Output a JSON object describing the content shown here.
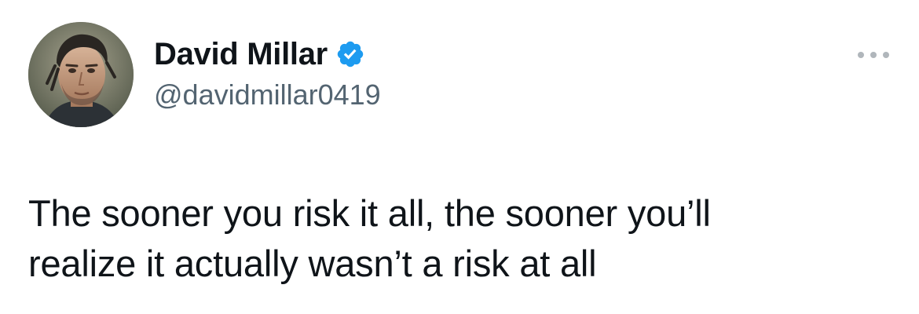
{
  "author": {
    "display_name": "David Millar",
    "handle": "@davidmillar0419",
    "verified": true,
    "avatar_icon": "profile-photo"
  },
  "tweet": {
    "lines": [
      "The sooner you risk it all, the sooner you’ll",
      "realize it actually wasn’t a risk at all"
    ]
  },
  "menu": {
    "icon": "more-options-icon"
  },
  "colors": {
    "text_primary": "#0f1419",
    "text_secondary": "#536471",
    "verified_blue": "#1d9bf0",
    "more_icon": "#b0b6bb"
  }
}
